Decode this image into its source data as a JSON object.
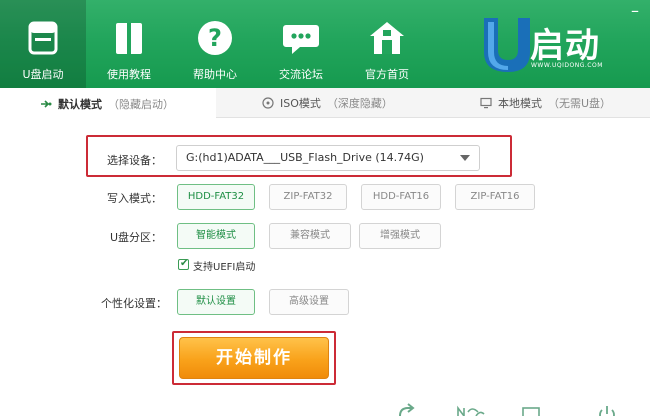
{
  "header": {
    "nav": [
      {
        "label": "U盘启动",
        "icon": "usb-drive-icon",
        "active": true
      },
      {
        "label": "使用教程",
        "icon": "book-icon",
        "active": false
      },
      {
        "label": "帮助中心",
        "icon": "question-icon",
        "active": false
      },
      {
        "label": "交流论坛",
        "icon": "chat-bubble-icon",
        "active": false
      },
      {
        "label": "官方首页",
        "icon": "home-icon",
        "active": false
      }
    ],
    "brand": {
      "name": "启动",
      "letter": "U",
      "url": "WWW.UQIDONG.COM"
    }
  },
  "tabs": [
    {
      "main": "默认模式",
      "sub": "（隐藏启动）",
      "icon": "arrow-icon",
      "active": true
    },
    {
      "main": "ISO模式",
      "sub": "（深度隐藏）",
      "icon": "disc-icon",
      "active": false
    },
    {
      "main": "本地模式",
      "sub": "（无需U盘）",
      "icon": "monitor-icon",
      "active": false
    }
  ],
  "form": {
    "device_label": "选择设备：",
    "device_value": "G:(hd1)ADATA___USB_Flash_Drive (14.74G)",
    "write_label": "写入模式：",
    "write_options": [
      "HDD-FAT32",
      "ZIP-FAT32",
      "HDD-FAT16",
      "ZIP-FAT16"
    ],
    "write_selected": "HDD-FAT32",
    "partition_label": "U盘分区：",
    "partition_options": [
      "智能模式",
      "兼容模式",
      "增强模式"
    ],
    "partition_selected": "智能模式",
    "uefi_label": "支持UEFI启动",
    "uefi_checked": true,
    "personal_label": "个性化设置：",
    "personal_options": [
      "默认设置",
      "高级设置"
    ],
    "personal_selected": "默认设置",
    "start_label": "开始制作"
  },
  "colors": {
    "header_green": "#22a55c",
    "highlight_red": "#cc2b36",
    "start_orange": "#f9a21a",
    "selected_green": "#1f8f45"
  }
}
